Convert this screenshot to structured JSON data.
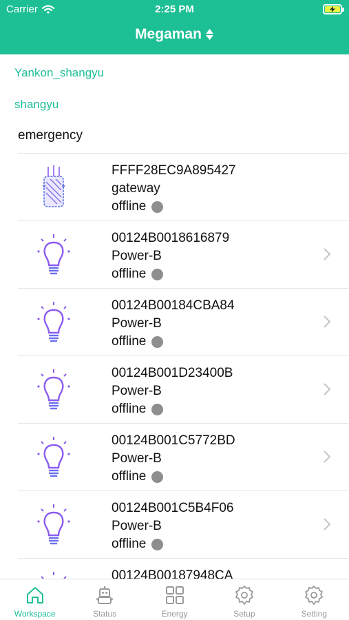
{
  "status_bar": {
    "carrier": "Carrier",
    "time": "2:25 PM"
  },
  "header": {
    "title": "Megaman"
  },
  "breadcrumbs": [
    "Yankon_shangyu",
    "shangyu"
  ],
  "section": {
    "title": "emergency"
  },
  "colors": {
    "accent": "#1dbf95",
    "offline_dot": "#8e8e8e",
    "icon_purple": "#8a5cf0"
  },
  "devices": [
    {
      "id": "FFFF28EC9A895427",
      "type": "gateway",
      "status": "offline",
      "icon": "gateway-icon",
      "has_chevron": false
    },
    {
      "id": "00124B0018616879",
      "type": "Power-B",
      "status": "offline",
      "icon": "bulb-icon",
      "has_chevron": true
    },
    {
      "id": "00124B00184CBA84",
      "type": "Power-B",
      "status": "offline",
      "icon": "bulb-icon",
      "has_chevron": true
    },
    {
      "id": "00124B001D23400B",
      "type": "Power-B",
      "status": "offline",
      "icon": "bulb-icon",
      "has_chevron": true
    },
    {
      "id": "00124B001C5772BD",
      "type": "Power-B",
      "status": "offline",
      "icon": "bulb-icon",
      "has_chevron": true
    },
    {
      "id": "00124B001C5B4F06",
      "type": "Power-B",
      "status": "offline",
      "icon": "bulb-icon",
      "has_chevron": true
    },
    {
      "id": "00124B00187948CA",
      "type": "",
      "status": "",
      "icon": "bulb-icon",
      "has_chevron": false
    }
  ],
  "tabs": [
    {
      "label": "Workspace",
      "icon": "home-icon",
      "active": true
    },
    {
      "label": "Status",
      "icon": "robot-icon",
      "active": false
    },
    {
      "label": "Energy",
      "icon": "grid-icon",
      "active": false
    },
    {
      "label": "Setup",
      "icon": "gear-icon",
      "active": false
    },
    {
      "label": "Setting",
      "icon": "gear-icon",
      "active": false
    }
  ]
}
